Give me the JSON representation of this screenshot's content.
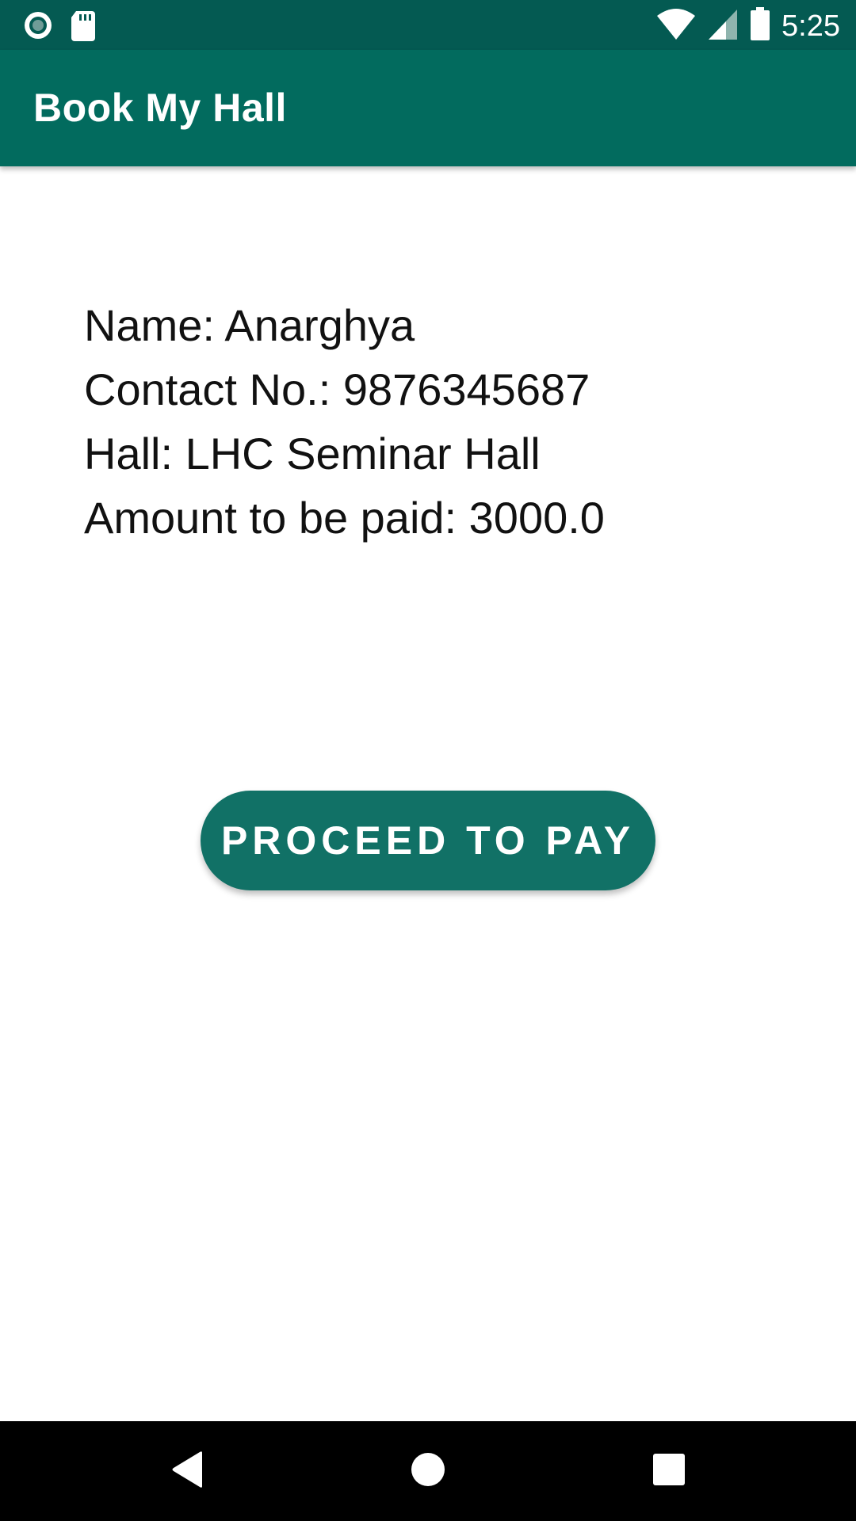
{
  "status_bar": {
    "time": "5:25",
    "icons": [
      "record-icon",
      "sd-card-icon",
      "wifi-icon",
      "cell-signal-icon",
      "battery-icon"
    ],
    "background": "#045a52"
  },
  "app_bar": {
    "title": "Book My Hall",
    "background": "#026b5e"
  },
  "details": {
    "name": "Name: Anarghya",
    "contact": "Contact No.: 9876345687",
    "hall": "Hall: LHC Seminar Hall",
    "amount": "Amount to be paid: 3000.0"
  },
  "actions": {
    "proceed_label": "PROCEED TO PAY",
    "button_color": "#117166"
  },
  "nav_bar": {
    "icons": [
      "back-icon",
      "home-icon",
      "recents-icon"
    ]
  }
}
